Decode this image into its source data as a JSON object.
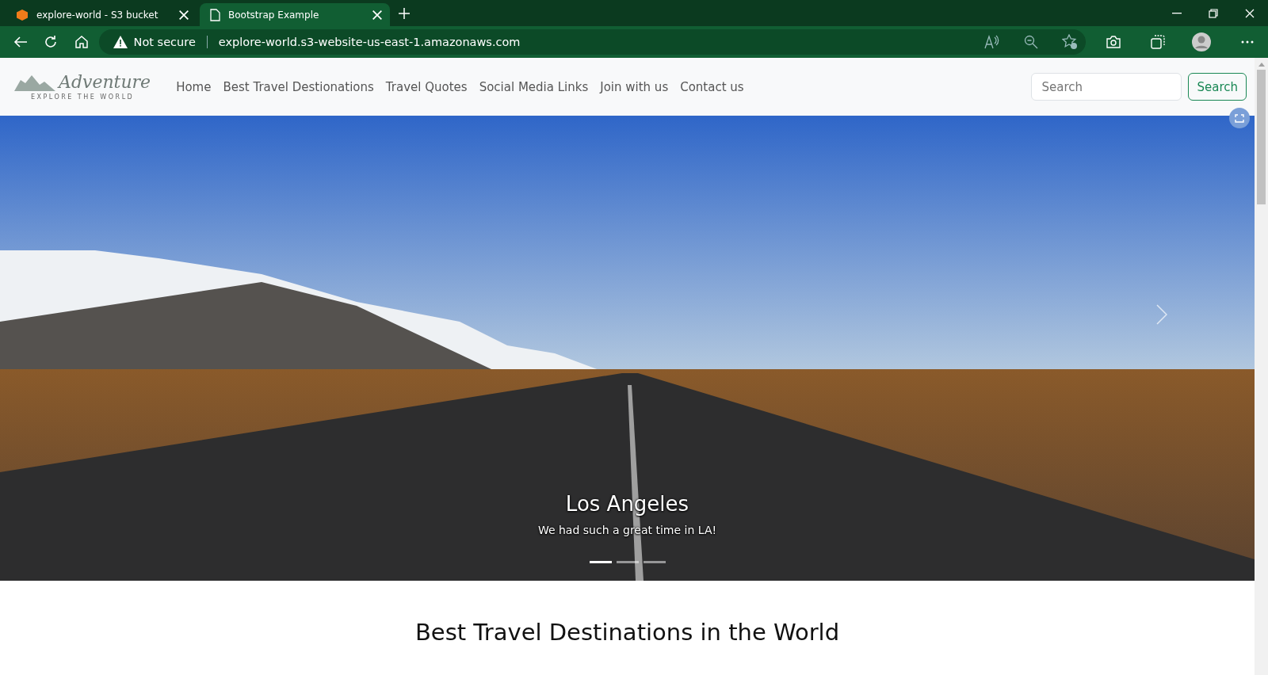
{
  "browser": {
    "tabs": [
      {
        "title": "explore-world - S3 bucket",
        "kind": "bucket",
        "selected": false
      },
      {
        "title": "Bootstrap Example",
        "kind": "page",
        "selected": true
      }
    ],
    "security": "Not secure",
    "url": "explore-world.s3-website-us-east-1.amazonaws.com"
  },
  "navbar": {
    "logo": {
      "name": "Adventure",
      "tagline": "EXPLORE THE WORLD"
    },
    "links": [
      "Home",
      "Best Travel Destionations",
      "Travel Quotes",
      "Social Media Links",
      "Join with us",
      "Contact us"
    ],
    "search": {
      "placeholder": "Search",
      "button": "Search"
    }
  },
  "carousel": {
    "caption": {
      "title": "Los Angeles",
      "text": "We had such a great time in LA!"
    },
    "indicators": [
      {
        "selected": true
      },
      {
        "selected": false
      },
      {
        "selected": false
      }
    ]
  },
  "section": {
    "heading": "Best Travel Destinations in the World"
  }
}
